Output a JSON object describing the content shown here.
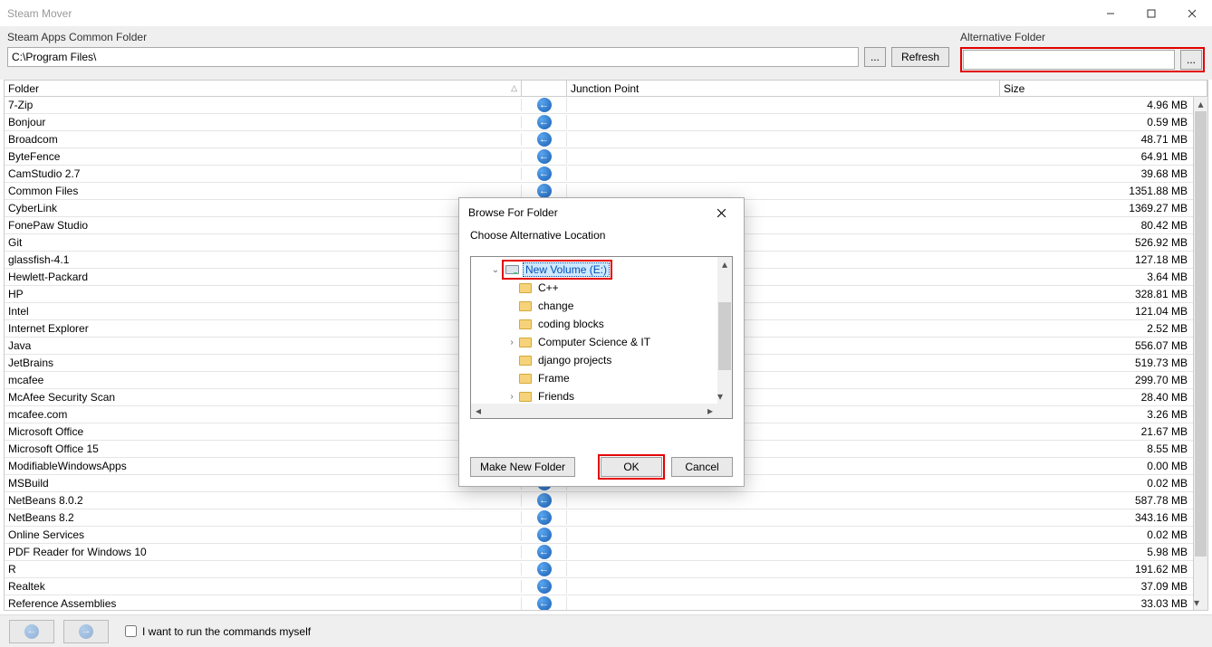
{
  "window": {
    "title": "Steam Mover"
  },
  "win_controls": {
    "min": "–",
    "max": "❐",
    "close": "✕"
  },
  "toolbar": {
    "source_label": "Steam Apps Common Folder",
    "source_value": "C:\\Program Files\\",
    "browse": "...",
    "refresh": "Refresh",
    "alt_label": "Alternative Folder",
    "alt_value": ""
  },
  "columns": {
    "folder": "Folder",
    "jp": "Junction Point",
    "size": "Size",
    "sort_glyph": "△"
  },
  "rows": [
    {
      "folder": "7-Zip",
      "size": "4.96 MB"
    },
    {
      "folder": "Bonjour",
      "size": "0.59 MB"
    },
    {
      "folder": "Broadcom",
      "size": "48.71 MB"
    },
    {
      "folder": "ByteFence",
      "size": "64.91 MB"
    },
    {
      "folder": "CamStudio 2.7",
      "size": "39.68 MB"
    },
    {
      "folder": "Common Files",
      "size": "1351.88 MB"
    },
    {
      "folder": "CyberLink",
      "size": "1369.27 MB"
    },
    {
      "folder": "FonePaw Studio",
      "size": "80.42 MB"
    },
    {
      "folder": "Git",
      "size": "526.92 MB"
    },
    {
      "folder": "glassfish-4.1",
      "size": "127.18 MB"
    },
    {
      "folder": "Hewlett-Packard",
      "size": "3.64 MB"
    },
    {
      "folder": "HP",
      "size": "328.81 MB"
    },
    {
      "folder": "Intel",
      "size": "121.04 MB"
    },
    {
      "folder": "Internet Explorer",
      "size": "2.52 MB"
    },
    {
      "folder": "Java",
      "size": "556.07 MB"
    },
    {
      "folder": "JetBrains",
      "size": "519.73 MB"
    },
    {
      "folder": "mcafee",
      "size": "299.70 MB"
    },
    {
      "folder": "McAfee Security Scan",
      "size": "28.40 MB"
    },
    {
      "folder": "mcafee.com",
      "size": "3.26 MB"
    },
    {
      "folder": "Microsoft Office",
      "size": "21.67 MB"
    },
    {
      "folder": "Microsoft Office 15",
      "size": "8.55 MB"
    },
    {
      "folder": "ModifiableWindowsApps",
      "size": "0.00 MB"
    },
    {
      "folder": "MSBuild",
      "size": "0.02 MB"
    },
    {
      "folder": "NetBeans 8.0.2",
      "size": "587.78 MB"
    },
    {
      "folder": "NetBeans 8.2",
      "size": "343.16 MB"
    },
    {
      "folder": "Online Services",
      "size": "0.02 MB"
    },
    {
      "folder": "PDF Reader for Windows 10",
      "size": "5.98 MB"
    },
    {
      "folder": "R",
      "size": "191.62 MB"
    },
    {
      "folder": "Realtek",
      "size": "37.09 MB"
    },
    {
      "folder": "Reference Assemblies",
      "size": "33.03 MB"
    }
  ],
  "footer": {
    "checkbox": "I want to run the commands myself"
  },
  "dialog": {
    "title": "Browse For Folder",
    "subtitle": "Choose Alternative Location",
    "tree": [
      {
        "depth": 0,
        "expand": "open",
        "icon": "drive",
        "label": "New Volume (E:)",
        "selected": true
      },
      {
        "depth": 1,
        "expand": "none",
        "icon": "folder",
        "label": "C++"
      },
      {
        "depth": 1,
        "expand": "none",
        "icon": "folder",
        "label": "change"
      },
      {
        "depth": 1,
        "expand": "none",
        "icon": "folder",
        "label": "coding blocks"
      },
      {
        "depth": 1,
        "expand": "closed",
        "icon": "folder",
        "label": "Computer Science & IT"
      },
      {
        "depth": 1,
        "expand": "none",
        "icon": "folder",
        "label": "django projects"
      },
      {
        "depth": 1,
        "expand": "none",
        "icon": "folder",
        "label": "Frame"
      },
      {
        "depth": 1,
        "expand": "closed",
        "icon": "folder",
        "label": "Friends"
      }
    ],
    "make_new": "Make New Folder",
    "ok": "OK",
    "cancel": "Cancel"
  },
  "col_widths": {
    "folder": 571,
    "arrow": 50,
    "jp": 478,
    "size": 205
  }
}
